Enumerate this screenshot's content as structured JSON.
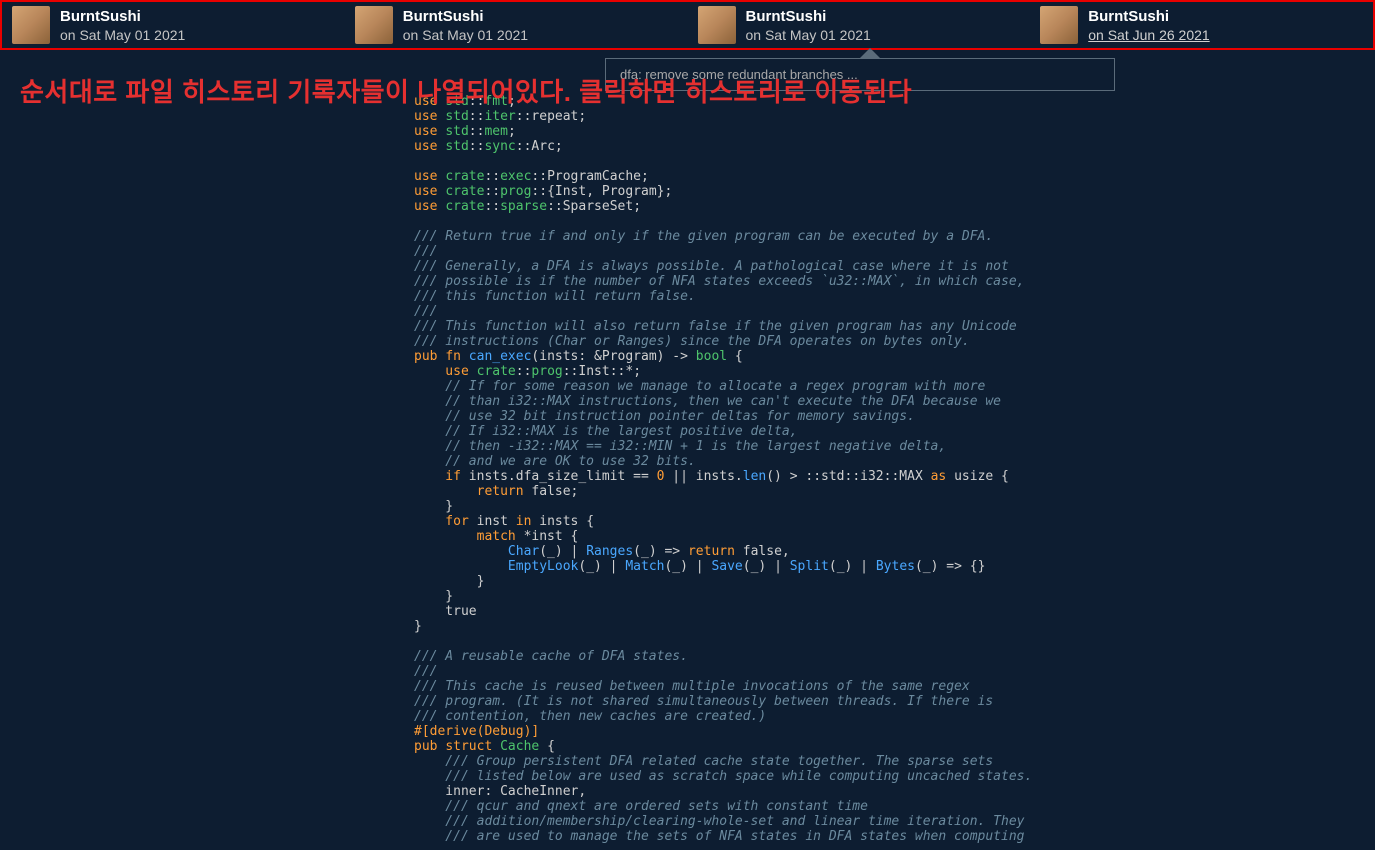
{
  "history": [
    {
      "author": "BurntSushi",
      "date": "on Sat May 01 2021",
      "active": false
    },
    {
      "author": "BurntSushi",
      "date": "on Sat May 01 2021",
      "active": false
    },
    {
      "author": "BurntSushi",
      "date": "on Sat May 01 2021",
      "active": false
    },
    {
      "author": "BurntSushi",
      "date": "on Sat Jun 26 2021",
      "active": true
    }
  ],
  "tooltip": "dfa: remove some redundant branches ...",
  "annotation": "순서대로 파일 히스토리 기록자들이 나열되어있다. 클릭하면 히스토리로 이동된다",
  "code": {
    "l01a": "use",
    "l01b": "std",
    "l01c": "fmt",
    "l02a": "use",
    "l02b": "std",
    "l02c": "iter",
    "l02d": "repeat",
    "l03a": "use",
    "l03b": "std",
    "l03c": "mem",
    "l04a": "use",
    "l04b": "std",
    "l04c": "sync",
    "l04d": "Arc",
    "l06a": "use",
    "l06b": "crate",
    "l06c": "exec",
    "l06d": "ProgramCache",
    "l07a": "use",
    "l07b": "crate",
    "l07c": "prog",
    "l07d": "{Inst, Program}",
    "l08a": "use",
    "l08b": "crate",
    "l08c": "sparse",
    "l08d": "SparseSet",
    "c01": "/// Return true if and only if the given program can be executed by a DFA.",
    "c02": "///",
    "c03": "/// Generally, a DFA is always possible. A pathological case where it is not",
    "c04": "/// possible is if the number of NFA states exceeds `u32::MAX`, in which case,",
    "c05": "/// this function will return false.",
    "c06": "///",
    "c07": "/// This function will also return false if the given program has any Unicode",
    "c08": "/// instructions (Char or Ranges) since the DFA operates on bytes only.",
    "f01a": "pub",
    "f01b": "fn",
    "f01c": "can_exec",
    "f01d": "(insts: &Program) -> ",
    "f01e": "bool",
    "f01f": " {",
    "f02a": "    use",
    "f02b": "crate",
    "f02c": "prog",
    "f02d": "Inst",
    "f02e": "*",
    "fc01": "    // If for some reason we manage to allocate a regex program with more",
    "fc02": "    // than i32::MAX instructions, then we can't execute the DFA because we",
    "fc03": "    // use 32 bit instruction pointer deltas for memory savings.",
    "fc04": "    // If i32::MAX is the largest positive delta,",
    "fc05": "    // then -i32::MAX == i32::MIN + 1 is the largest negative delta,",
    "fc06": "    // and we are OK to use 32 bits.",
    "if1a": "    if",
    "if1b": " insts.dfa_size_limit == ",
    "if1c": "0",
    "if1d": " || insts.",
    "if1e": "len",
    "if1f": "() > ::std::i32::MAX ",
    "if1g": "as",
    "if1h": " usize {",
    "ret1a": "        return",
    "ret1b": " false;",
    "br1": "    }",
    "for1a": "    for",
    "for1b": " inst ",
    "for1c": "in",
    "for1d": " insts {",
    "mat1a": "        match",
    "mat1b": " *inst {",
    "arm1a": "            Char",
    "arm1b": "(_) | ",
    "arm1c": "Ranges",
    "arm1d": "(_) => ",
    "arm1e": "return",
    "arm1f": " false,",
    "arm2a": "            EmptyLook",
    "arm2b": "(_) | ",
    "arm2c": "Match",
    "arm2d": "(_) | ",
    "arm2e": "Save",
    "arm2f": "(_) | ",
    "arm2g": "Split",
    "arm2h": "(_) | ",
    "arm2i": "Bytes",
    "arm2j": "(_) => {}",
    "br2": "        }",
    "br3": "    }",
    "tr": "    true",
    "br4": "}",
    "cc01": "/// A reusable cache of DFA states.",
    "cc02": "///",
    "cc03": "/// This cache is reused between multiple invocations of the same regex",
    "cc04": "/// program. (It is not shared simultaneously between threads. If there is",
    "cc05": "/// contention, then new caches are created.)",
    "der": "#[derive(Debug)]",
    "st1a": "pub",
    "st1b": "struct",
    "st1c": "Cache",
    "st1d": " {",
    "sc01": "    /// Group persistent DFA related cache state together. The sparse sets",
    "sc02": "    /// listed below are used as scratch space while computing uncached states.",
    "fld1": "    inner: CacheInner,",
    "sc03": "    /// qcur and qnext are ordered sets with constant time",
    "sc04": "    /// addition/membership/clearing-whole-set and linear time iteration. They",
    "sc05": "    /// are used to manage the sets of NFA states in DFA states when computing"
  }
}
